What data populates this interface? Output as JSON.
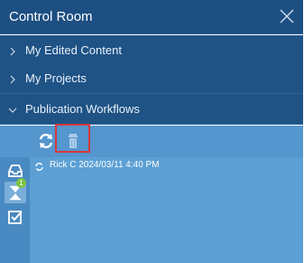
{
  "window": {
    "title": "Control Room",
    "close_icon": "close-icon"
  },
  "sections": [
    {
      "label": "My Edited Content",
      "state": "collapsed",
      "icon": "chevron-right-icon"
    },
    {
      "label": "My Projects",
      "state": "collapsed",
      "icon": "chevron-right-icon"
    },
    {
      "label": "Publication Workflows",
      "state": "expanded",
      "icon": "chevron-down-icon"
    }
  ],
  "toolbar": {
    "buttons": [
      {
        "name": "refresh-icon",
        "highlighted": false
      },
      {
        "name": "trash-icon",
        "highlighted": true
      }
    ]
  },
  "sidebar": {
    "items": [
      {
        "name": "inbox-icon"
      },
      {
        "name": "hourglass-icon",
        "badge": "1",
        "active": true
      },
      {
        "name": "checkbox-icon"
      }
    ]
  },
  "workflows": [
    {
      "text": "Rick C 2024/03/11 4:40 PM",
      "status_icon": "workflow-status-icon"
    }
  ],
  "colors": {
    "titlebar": "#1d4f82",
    "section": "#1f5386",
    "content": "#5b9fd4",
    "highlight": "#d9363e",
    "badge": "#7cc242"
  }
}
